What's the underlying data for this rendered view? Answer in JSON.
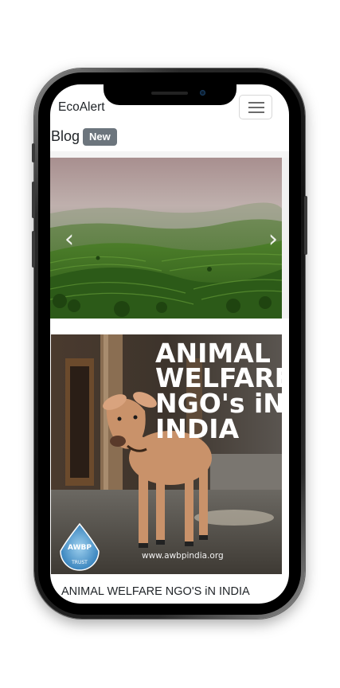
{
  "navbar": {
    "brand": "EcoAlert",
    "toggler_icon": "hamburger-menu-icon"
  },
  "page": {
    "heading": "Blog",
    "badge": "New"
  },
  "carousel": {
    "prev_glyph": "‹",
    "next_glyph": "›",
    "prev_icon": "chevron-left-icon",
    "next_icon": "chevron-right-icon"
  },
  "card": {
    "image_lines": [
      "ANIMAL",
      "WELFARE",
      "NGO's iN",
      "INDIA"
    ],
    "logo_text": "AWBP",
    "logo_subtext": "TRUST",
    "watermark": "www.awbpindia.org",
    "title": "ANIMAL WELFARE NGO'S iN INDIA"
  }
}
